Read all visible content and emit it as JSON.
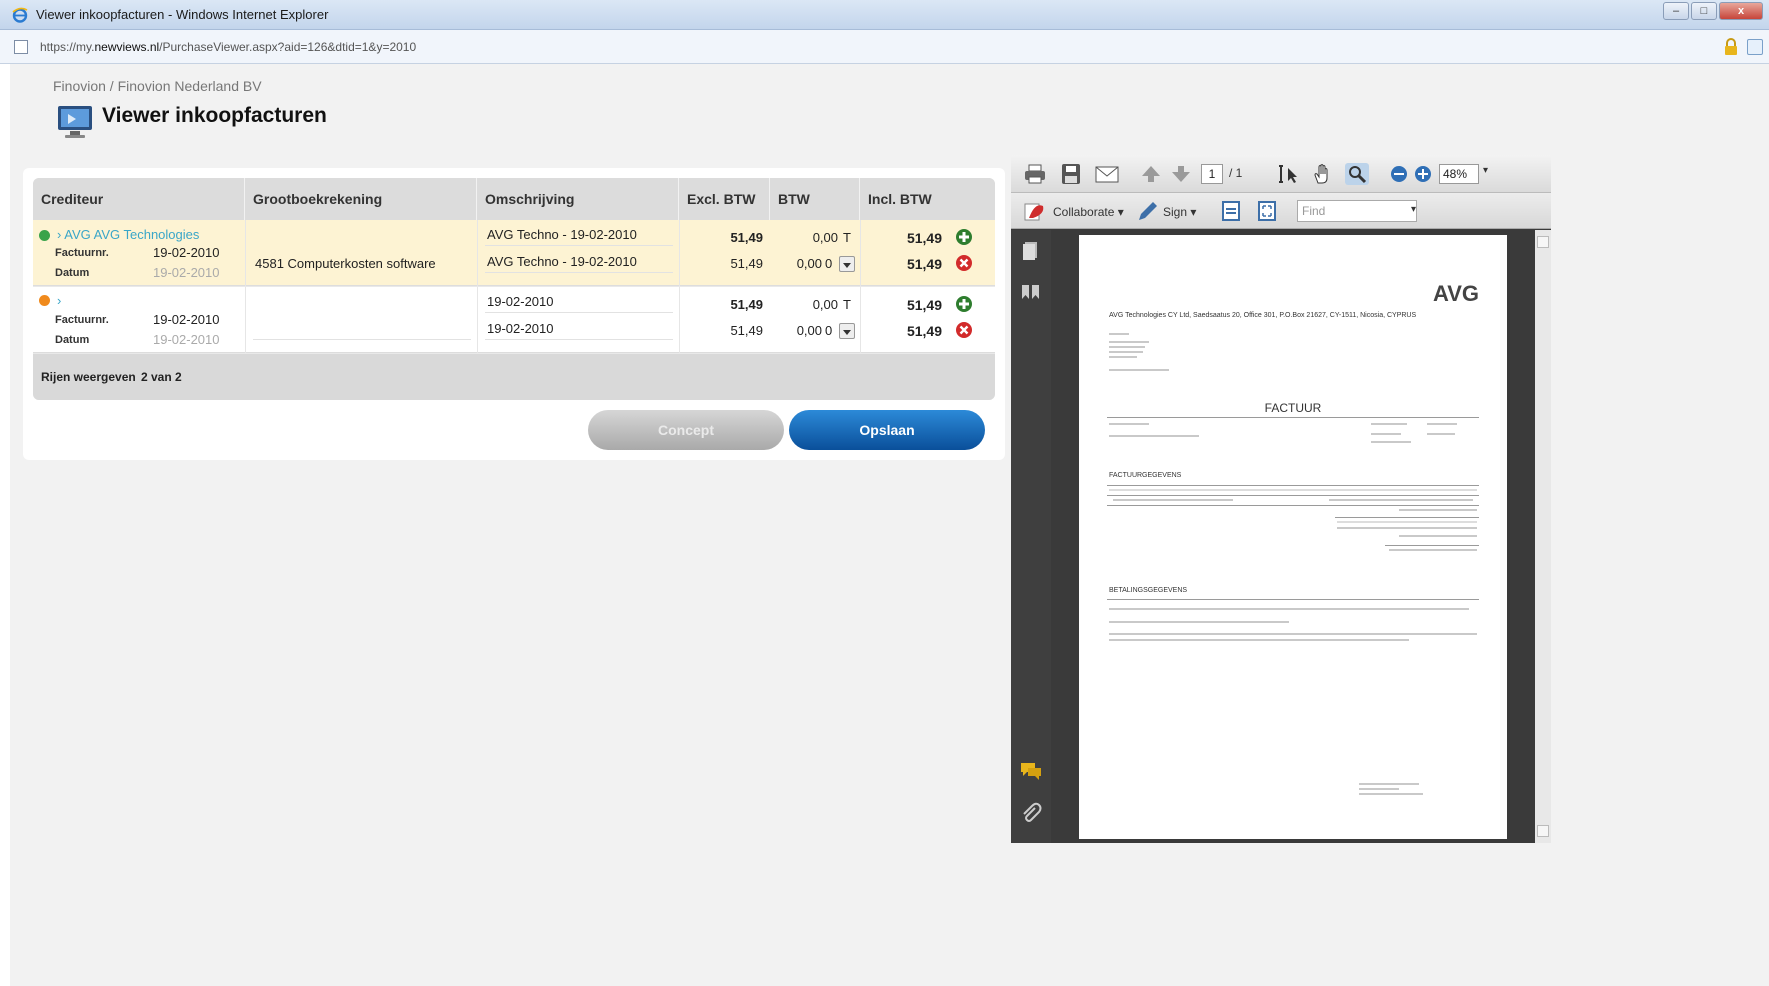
{
  "window": {
    "title": "Viewer inkoopfacturen - Windows Internet Explorer",
    "minimize": "–",
    "maximize": "□",
    "close": "x",
    "url_prefix": "https://my.",
    "url_domain": "newviews.nl",
    "url_path": "/PurchaseViewer.aspx?aid=126&dtid=1&y=2010"
  },
  "page": {
    "breadcrumb": "Finovion / Finovion Nederland BV",
    "title": "Viewer inkoopfacturen"
  },
  "grid": {
    "columns": [
      "Crediteur",
      "Grootboekrekening",
      "Omschrijving",
      "Excl. BTW",
      "BTW",
      "Incl. BTW"
    ],
    "labels": {
      "invoice_no": "Factuurnr.",
      "date": "Datum"
    },
    "rows": [
      {
        "status_color": "#3aa34a",
        "creditor": "AVG AVG Technologies",
        "invoice_no": "19-02-2010",
        "date": "19-02-2010",
        "ledger": "4581 Computerkosten software",
        "lines": [
          {
            "description": "AVG Techno - 19-02-2010",
            "excl": "51,49",
            "btw": "0,00",
            "btw_code": "T",
            "incl": "51,49",
            "action": "add"
          },
          {
            "description": "AVG Techno - 19-02-2010",
            "excl": "51,49",
            "btw": "0,00",
            "btw_code": "0",
            "incl": "51,49",
            "action": "remove"
          }
        ]
      },
      {
        "status_color": "#f08a1c",
        "creditor": "",
        "invoice_no": "19-02-2010",
        "date": "19-02-2010",
        "ledger": "",
        "lines": [
          {
            "description": "19-02-2010",
            "excl": "51,49",
            "btw": "0,00",
            "btw_code": "T",
            "incl": "51,49",
            "action": "add"
          },
          {
            "description": "19-02-2010",
            "excl": "51,49",
            "btw": "0,00",
            "btw_code": "0",
            "incl": "51,49",
            "action": "remove"
          }
        ]
      }
    ],
    "footer": {
      "label": "Rijen weergeven",
      "value": "2 van 2"
    }
  },
  "buttons": {
    "concept": "Concept",
    "save": "Opslaan"
  },
  "pdf": {
    "page_current": "1",
    "page_total": "/ 1",
    "zoom": "48%",
    "collaborate": "Collaborate",
    "sign": "Sign",
    "find_placeholder": "Find",
    "doc": {
      "logo": "AVG",
      "sender_line": "AVG Technologies CY Ltd, Saedsaatus 20, Office 301, P.O.Box 21627, CY-1511, Nicosia, CYPRUS",
      "heading": "FACTUUR",
      "section_invoice": "FACTUURGEGEVENS",
      "section_payment": "BETALINGSGEGEVENS"
    }
  },
  "colors": {
    "accent_blue": "#0a4f9a",
    "link": "#3aa6c8",
    "row_highlight": "#fdf3d3",
    "add_icon": "#2e7d2e",
    "remove_icon": "#d22b2b"
  }
}
